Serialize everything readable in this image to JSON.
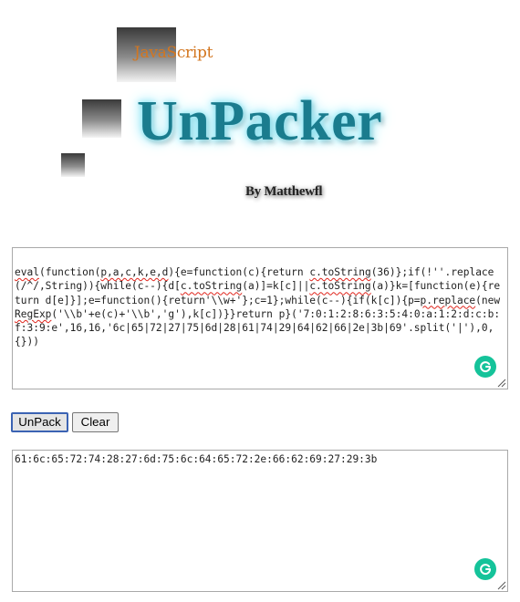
{
  "logo": {
    "javascript_label": "JavaScript",
    "title": "UnPacker",
    "byline": "By Matthewfl"
  },
  "input": {
    "segments": [
      {
        "text": "eval",
        "underline": true
      },
      {
        "text": "(function(",
        "underline": false
      },
      {
        "text": "p,a,c,k,e,d",
        "underline": true
      },
      {
        "text": "){e=function(c){return ",
        "underline": false
      },
      {
        "text": "c.toString",
        "underline": true
      },
      {
        "text": "(36)};if(!''.replace(/^/,String)){while(c--){d[",
        "underline": false
      },
      {
        "text": "c.toString",
        "underline": true
      },
      {
        "text": "(a)]=k[c]||",
        "underline": false
      },
      {
        "text": "c.toString",
        "underline": true
      },
      {
        "text": "(a)}k=[function(e){return d[e]}];e=function(){return'\\\\w+'};c=1};while(c--){if(k[c]){p=",
        "underline": false
      },
      {
        "text": "p.replace",
        "underline": true
      },
      {
        "text": "(new ",
        "underline": false
      },
      {
        "text": "RegExp",
        "underline": true
      },
      {
        "text": "('\\\\b'+e(c)+'\\\\b','g'),k[c])}}return p}('7:0:1:2:8:6:3:5:4:0:a:1:2:d:c:b:f:3:9:e',16,16,'6c|65|72|27|75|6d|28|61|74|29|64|62|66|2e|3b|69'.split('|'),0,{}))",
        "underline": false
      }
    ]
  },
  "buttons": {
    "unpack_label": "UnPack",
    "clear_label": "Clear"
  },
  "output": {
    "value": "61:6c:65:72:74:28:27:6d:75:6c:64:65:72:2e:66:62:69:27:29:3b"
  },
  "colors": {
    "javascript_label": "#d3761f",
    "title": "#1a7c8e",
    "title_glow": "#8fe6f5",
    "grammarly": "#15c39a",
    "focus_border": "#3b63b3"
  },
  "icons": {
    "grammarly": "grammarly-icon",
    "resize": "resize-grip-icon"
  }
}
